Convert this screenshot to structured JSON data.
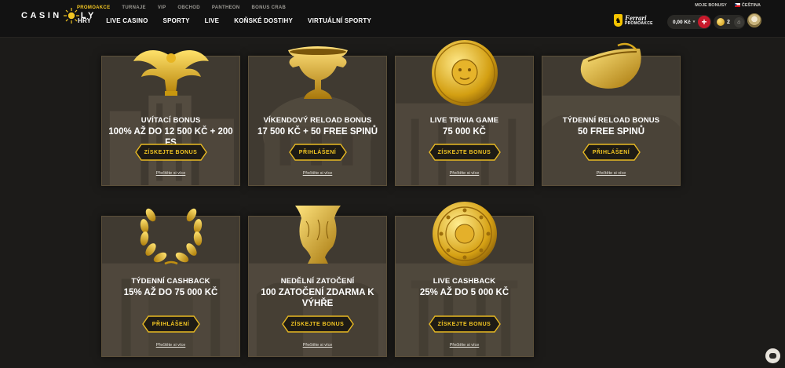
{
  "header": {
    "logo_text_left": "CASIN",
    "logo_text_right": "LY",
    "top_nav": [
      "PROMOAKCE",
      "TURNAJE",
      "VIP",
      "OBCHOD",
      "PANTHEON",
      "BONUS CRAB"
    ],
    "main_nav": [
      "HRY",
      "LIVE CASINO",
      "SPORTY",
      "LIVE",
      "KOŇSKÉ DOSTIHY",
      "VIRTUÁLNÍ SPORTY"
    ],
    "my_bonuses": "MOJE BONUSY",
    "language": "ČEŠTINA",
    "ferrari_brand": "Ferrari",
    "ferrari_sub": "PROMOAKCE",
    "balance": "0,00 Kč",
    "coins": "2",
    "accent": "#f3c623"
  },
  "cards": [
    {
      "title": "UVÍTACÍ BONUS",
      "offer": "100% AŽ DO 12 500 KČ + 200 FS",
      "cta": "ZÍSKEJTE BONUS",
      "more": "Přečtěte si více",
      "art": "eagle"
    },
    {
      "title": "VÍKENDOVÝ RELOAD BONUS",
      "offer": "17 500 KČ + 50 FREE SPINŮ",
      "cta": "PŘIHLÁŠENÍ",
      "more": "Přečtěte si více",
      "art": "goblet"
    },
    {
      "title": "LIVE TRIVIA GAME",
      "offer": "75 000 KČ",
      "cta": "ZÍSKEJTE BONUS",
      "more": "Přečtěte si více",
      "art": "medusa-shield"
    },
    {
      "title": "TÝDENNÍ RELOAD BONUS",
      "offer": "50 FREE SPINŮ",
      "cta": "PŘIHLÁŠENÍ",
      "more": "Přečtěte si více",
      "art": "boat-vessel"
    },
    {
      "title": "TÝDENNÍ CASHBACK",
      "offer": "15% AŽ DO 75 000 KČ",
      "cta": "PŘIHLÁŠENÍ",
      "more": "Přečtěte si více",
      "art": "laurel-wreath"
    },
    {
      "title": "NEDĚLNÍ ZATOČENÍ",
      "offer": "100 ZATOČENÍ ZDARMA K VÝHŘE",
      "cta": "ZÍSKEJTE BONUS",
      "more": "Přečtěte si více",
      "art": "vase"
    },
    {
      "title": "LIVE CASHBACK",
      "offer": "25% AŽ DO 5 000 KČ",
      "cta": "ZÍSKEJTE BONUS",
      "more": "Přečtěte si více",
      "art": "gold-coin"
    }
  ]
}
